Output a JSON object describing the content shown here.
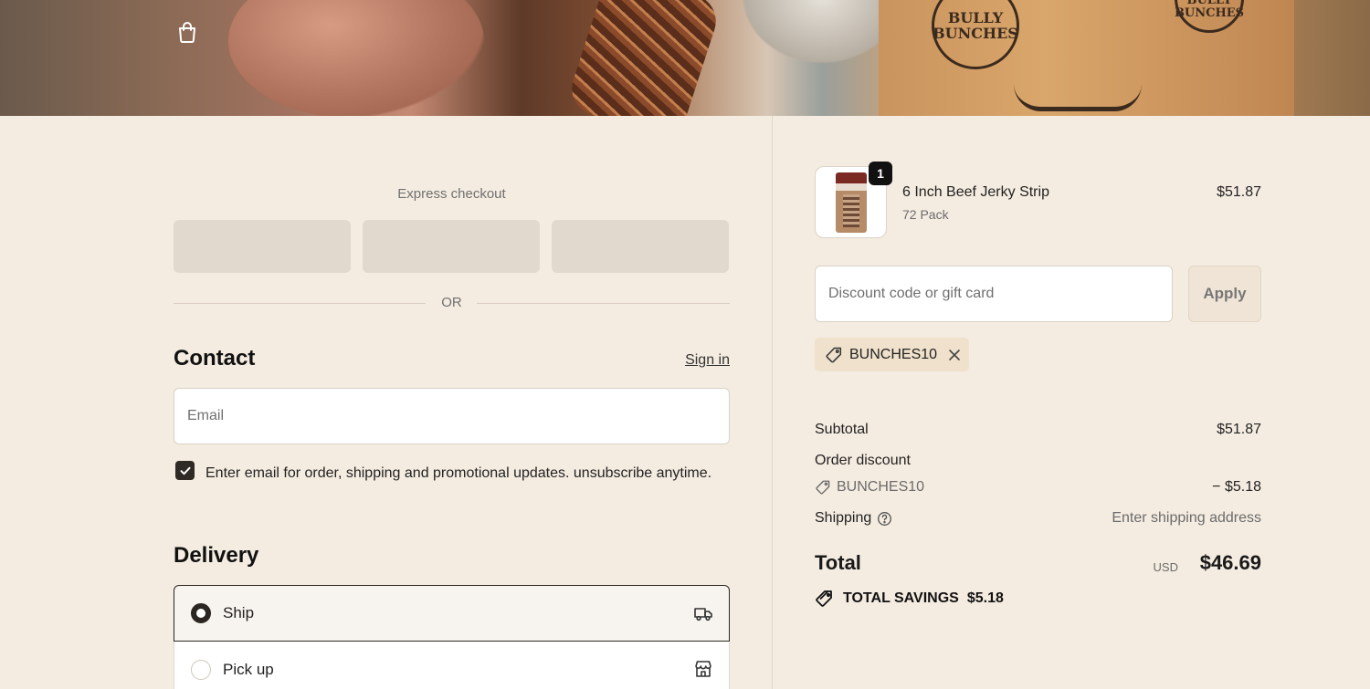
{
  "hero": {
    "logo_primary": "BULLY BUNCHES",
    "logo_secondary": "BULLY BUNCHES"
  },
  "express": {
    "label": "Express checkout",
    "or_label": "OR"
  },
  "contact": {
    "title": "Contact",
    "sign_in": "Sign in",
    "email_placeholder": "Email",
    "marketing_checked": true,
    "marketing_label": "Enter email for order, shipping and promotional updates. unsubscribe anytime."
  },
  "delivery": {
    "title": "Delivery",
    "options": [
      {
        "label": "Ship",
        "selected": true,
        "icon": "truck-icon"
      },
      {
        "label": "Pick up",
        "selected": false,
        "icon": "store-icon"
      }
    ]
  },
  "order": {
    "item": {
      "name": "6 Inch Beef Jerky Strip",
      "variant": "72 Pack",
      "price": "$51.87",
      "quantity": "1"
    },
    "discount_placeholder": "Discount code or gift card",
    "apply_label": "Apply",
    "applied_code": "BUNCHES10",
    "subtotal_label": "Subtotal",
    "subtotal_value": "$51.87",
    "order_discount_label": "Order discount",
    "discount_code": "BUNCHES10",
    "discount_value": "− $5.18",
    "shipping_label": "Shipping",
    "shipping_value": "Enter shipping address",
    "total_label": "Total",
    "currency": "USD",
    "total_value": "$46.69",
    "savings_label": "TOTAL SAVINGS",
    "savings_value": "$5.18"
  },
  "colors": {
    "background": "#f5ece1",
    "accent_dark": "#2b2622",
    "chip": "#efe1cb"
  }
}
